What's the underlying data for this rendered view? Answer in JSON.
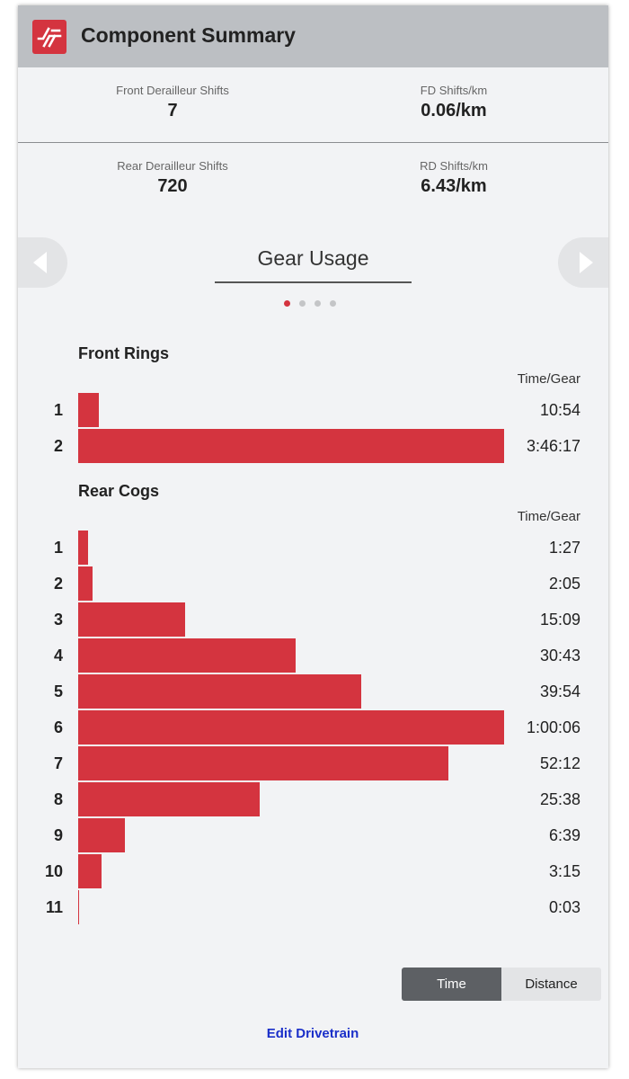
{
  "header": {
    "title": "Component Summary",
    "logo_icon": "brand-logo-icon"
  },
  "stats": {
    "front_shifts_label": "Front Derailleur Shifts",
    "front_shifts_value": "7",
    "fd_per_km_label": "FD Shifts/km",
    "fd_per_km_value": "0.06/km",
    "rear_shifts_label": "Rear Derailleur Shifts",
    "rear_shifts_value": "720",
    "rd_per_km_label": "RD Shifts/km",
    "rd_per_km_value": "6.43/km"
  },
  "carousel": {
    "title": "Gear Usage",
    "page_count": 4,
    "active_page": 1,
    "prev_icon": "chevron-left-icon",
    "next_icon": "chevron-right-icon"
  },
  "colors": {
    "accent": "#d4343f",
    "link": "#1a2fc9",
    "header_bg": "#bcbfc3"
  },
  "front": {
    "title": "Front Rings",
    "column_header": "Time/Gear",
    "rows": [
      {
        "label": "1",
        "time": "10:54",
        "seconds": 654
      },
      {
        "label": "2",
        "time": "3:46:17",
        "seconds": 13577
      }
    ]
  },
  "rear": {
    "title": "Rear Cogs",
    "column_header": "Time/Gear",
    "rows": [
      {
        "label": "1",
        "time": "1:27",
        "seconds": 87
      },
      {
        "label": "2",
        "time": "2:05",
        "seconds": 125
      },
      {
        "label": "3",
        "time": "15:09",
        "seconds": 909
      },
      {
        "label": "4",
        "time": "30:43",
        "seconds": 1843
      },
      {
        "label": "5",
        "time": "39:54",
        "seconds": 2394
      },
      {
        "label": "6",
        "time": "1:00:06",
        "seconds": 3606
      },
      {
        "label": "7",
        "time": "52:12",
        "seconds": 3132
      },
      {
        "label": "8",
        "time": "25:38",
        "seconds": 1538
      },
      {
        "label": "9",
        "time": "6:39",
        "seconds": 399
      },
      {
        "label": "10",
        "time": "3:15",
        "seconds": 195
      },
      {
        "label": "11",
        "time": "0:03",
        "seconds": 3
      }
    ]
  },
  "toggle": {
    "time_label": "Time",
    "distance_label": "Distance",
    "selected": "Time"
  },
  "edit_link": "Edit Drivetrain"
}
